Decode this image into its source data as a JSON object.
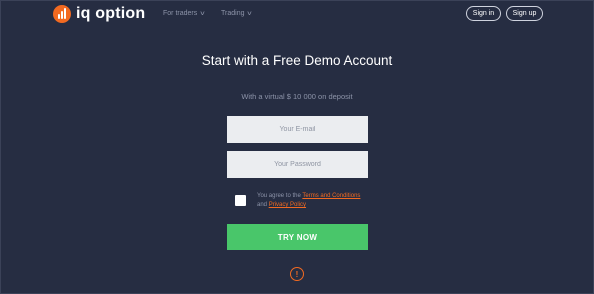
{
  "brand": {
    "name": "iq option",
    "accent": "#f26a21"
  },
  "nav": [
    {
      "label": "For traders"
    },
    {
      "label": "Trading"
    }
  ],
  "auth": {
    "signin_label": "Sign in",
    "signup_label": "Sign up"
  },
  "form": {
    "title": "Start with a Free Demo Account",
    "subtitle": "With a virtual $ 10 000 on deposit",
    "email_placeholder": "Your E-mail",
    "password_placeholder": "Your Password",
    "agree_prefix": "You agree to the",
    "terms_link": "Terms and Conditions",
    "agree_and": "and",
    "privacy_link": "Privacy Policy",
    "submit_label": "TRY NOW"
  },
  "alert_glyph": "!",
  "colors": {
    "background": "#262d42",
    "button": "#49c66a",
    "muted_text": "#8c93a8"
  }
}
